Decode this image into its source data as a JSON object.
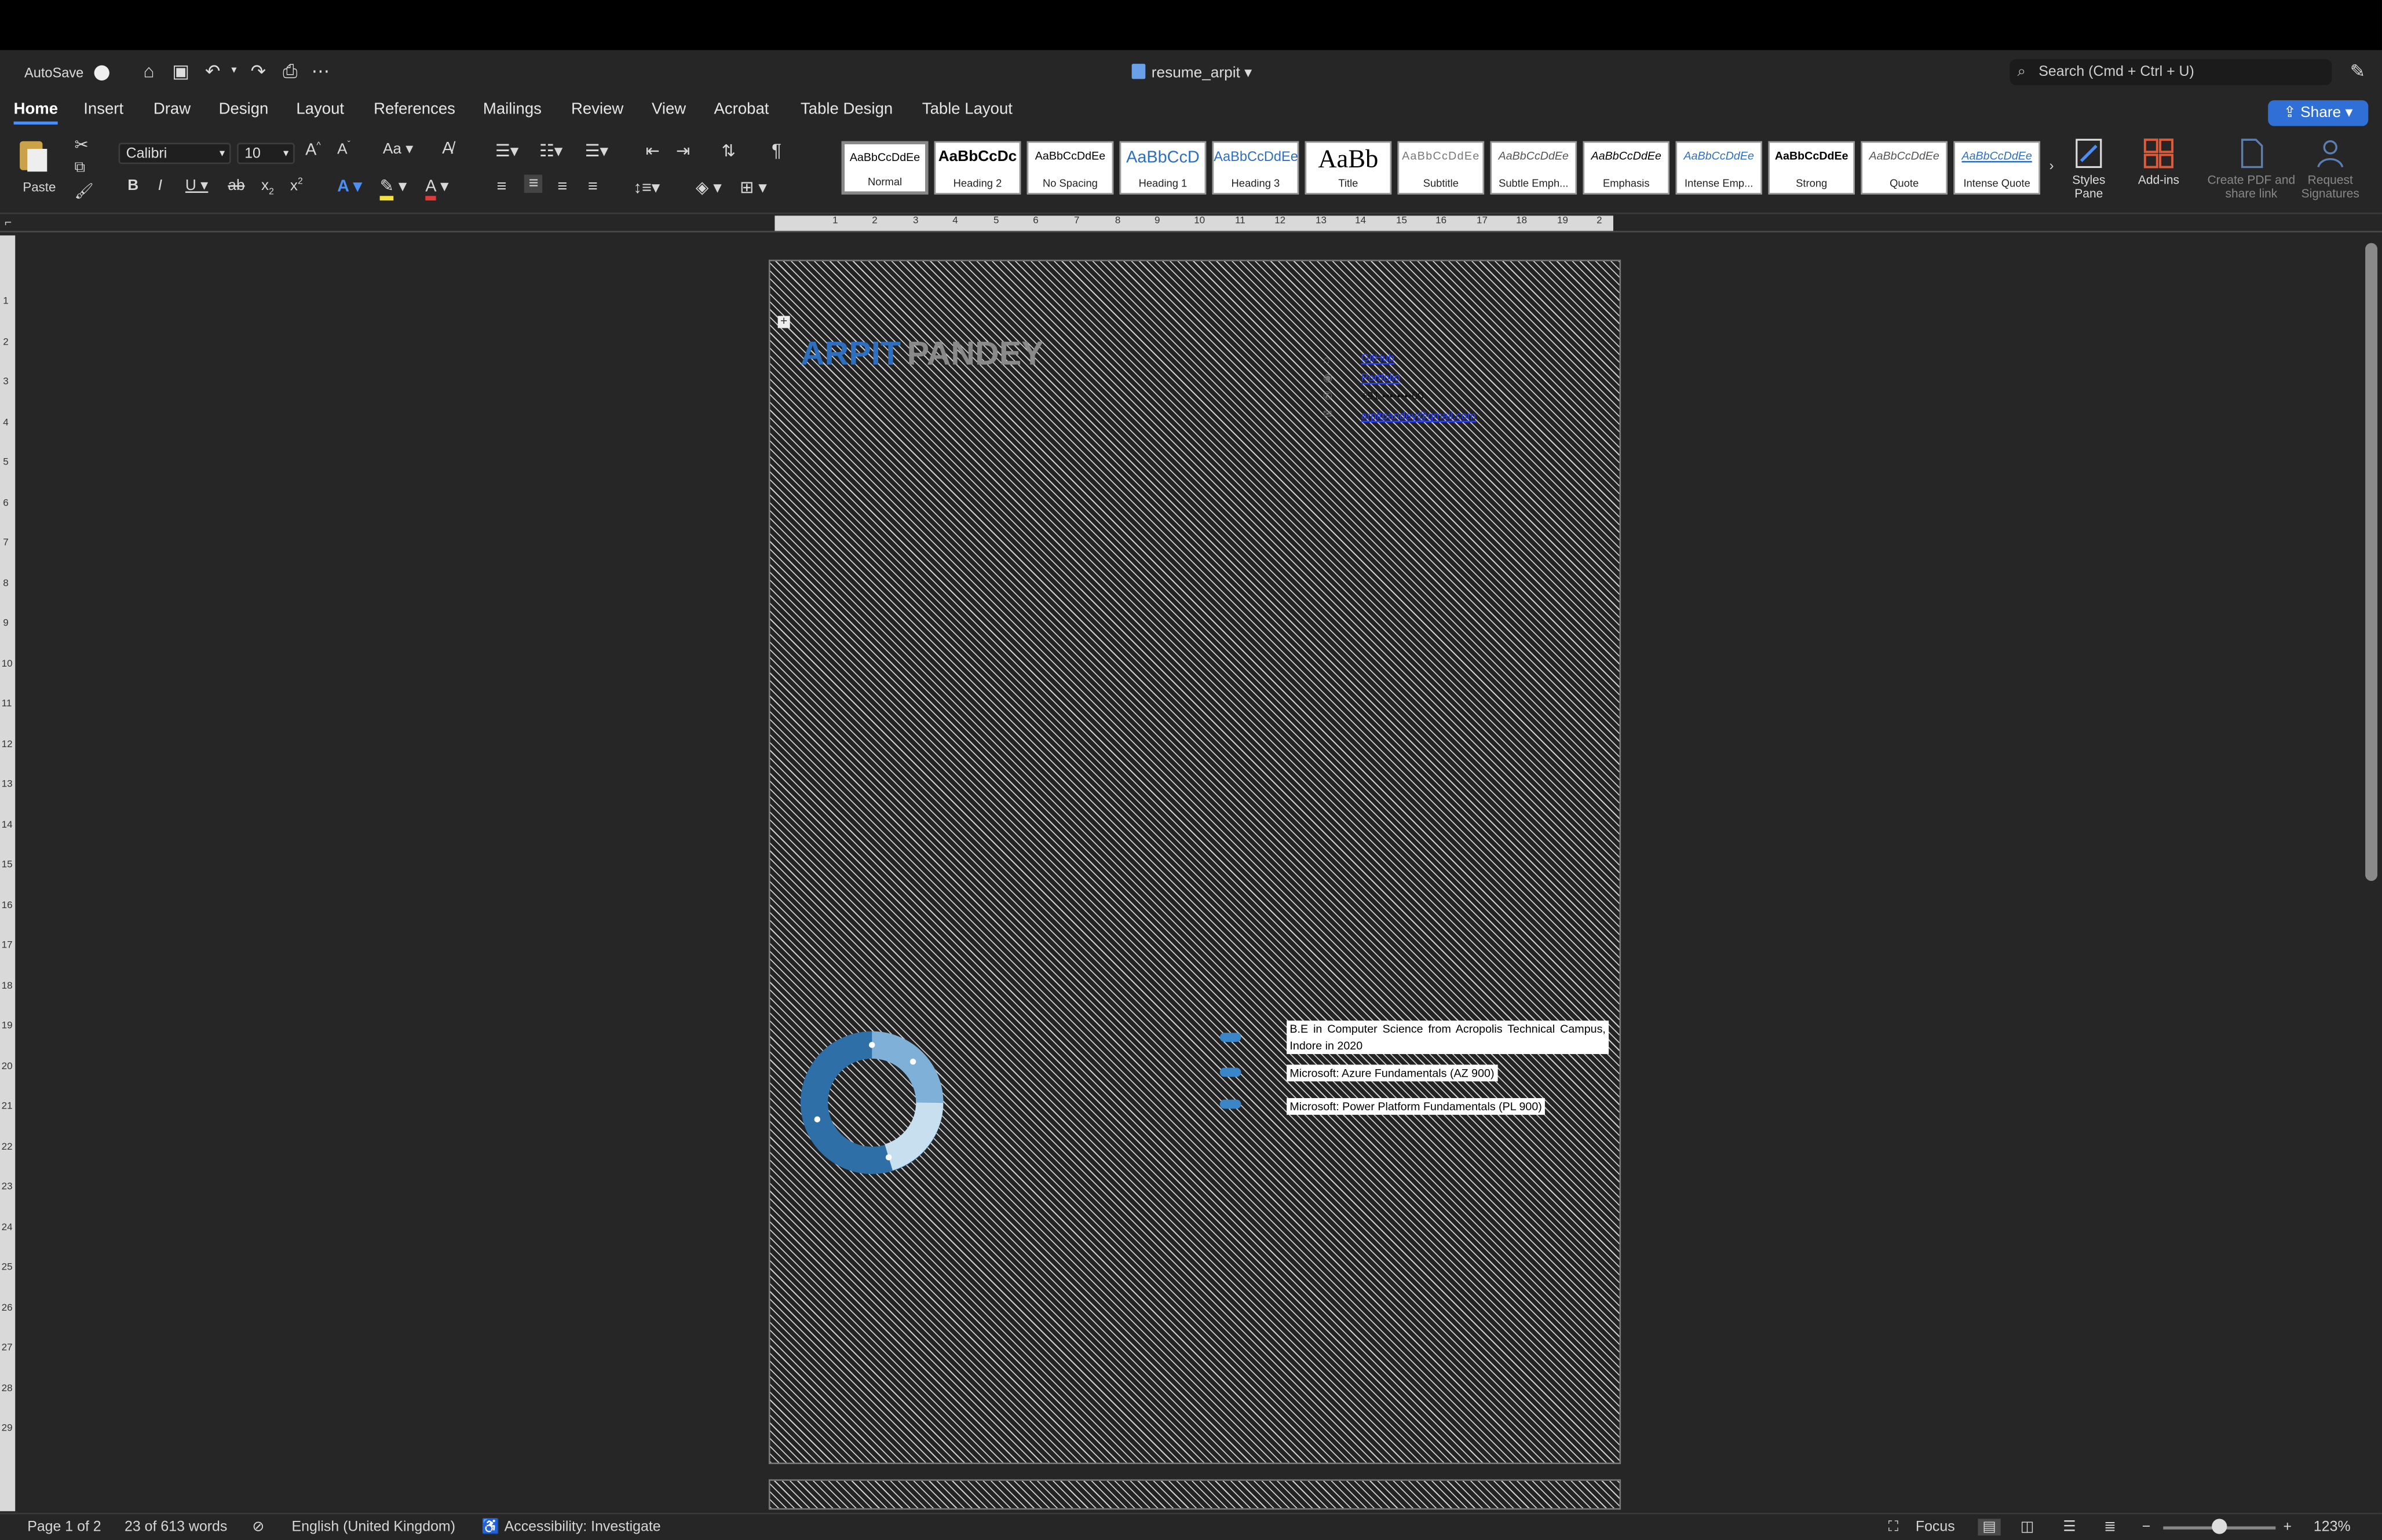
{
  "window": {
    "autosave_label": "AutoSave",
    "doc_title": "resume_arpit",
    "search_placeholder": "Search (Cmd + Ctrl + U)",
    "share_label": "Share"
  },
  "menu_tabs": [
    "Home",
    "Insert",
    "Draw",
    "Design",
    "Layout",
    "References",
    "Mailings",
    "Review",
    "View",
    "Acrobat",
    "Table Design",
    "Table Layout"
  ],
  "ribbon": {
    "paste_label": "Paste",
    "font_name": "Calibri",
    "font_size": "10",
    "styles": [
      {
        "sample": "AaBbCcDdEe",
        "name": "Normal"
      },
      {
        "sample": "AaBbCcDc",
        "name": "Heading 2"
      },
      {
        "sample": "AaBbCcDdEe",
        "name": "No Spacing"
      },
      {
        "sample": "AaBbCcD",
        "name": "Heading 1"
      },
      {
        "sample": "AaBbCcDdEe",
        "name": "Heading 3"
      },
      {
        "sample": "AaBb",
        "name": "Title"
      },
      {
        "sample": "AaBbCcDdEe",
        "name": "Subtitle"
      },
      {
        "sample": "AaBbCcDdEe",
        "name": "Subtle Emph..."
      },
      {
        "sample": "AaBbCcDdEe",
        "name": "Emphasis"
      },
      {
        "sample": "AaBbCcDdEe",
        "name": "Intense Emp..."
      },
      {
        "sample": "AaBbCcDdEe",
        "name": "Strong"
      },
      {
        "sample": "AaBbCcDdEe",
        "name": "Quote"
      },
      {
        "sample": "AaBbCcDdEe",
        "name": "Intense Quote"
      }
    ],
    "styles_pane_label": "Styles Pane",
    "addins_label": "Add-ins",
    "create_pdf_label": "Create PDF and share link",
    "request_sig_label": "Request Signatures"
  },
  "ruler_h": [
    "1",
    "2",
    "3",
    "4",
    "5",
    "6",
    "7",
    "8",
    "9",
    "10",
    "11",
    "12",
    "13",
    "14",
    "15",
    "16",
    "17",
    "18",
    "19",
    "2"
  ],
  "ruler_v": [
    "1",
    "2",
    "3",
    "4",
    "5",
    "6",
    "7",
    "8",
    "9",
    "10",
    "11",
    "12",
    "13",
    "14",
    "15",
    "16",
    "17",
    "18",
    "19",
    "20",
    "21",
    "22",
    "23",
    "24",
    "25",
    "26",
    "27",
    "28",
    "29"
  ],
  "document": {
    "name_first": "ARPIT",
    "name_last": "PANDEY",
    "contacts": [
      "GitHub",
      "Portfolio",
      "+91 ••••••••00",
      "arpitpandey@gmail.com"
    ],
    "certifications": [
      "B.E in Computer Science from Acropolis Technical Campus, Indore in 2020",
      "Microsoft: Azure Fundamentals (AZ 900)",
      "Microsoft: Power Platform Fundamentals (PL 900)"
    ]
  },
  "status": {
    "page": "Page 1 of 2",
    "words": "23 of 613 words",
    "language": "English (United Kingdom)",
    "accessibility": "Accessibility: Investigate",
    "focus": "Focus",
    "zoom": "123%"
  }
}
